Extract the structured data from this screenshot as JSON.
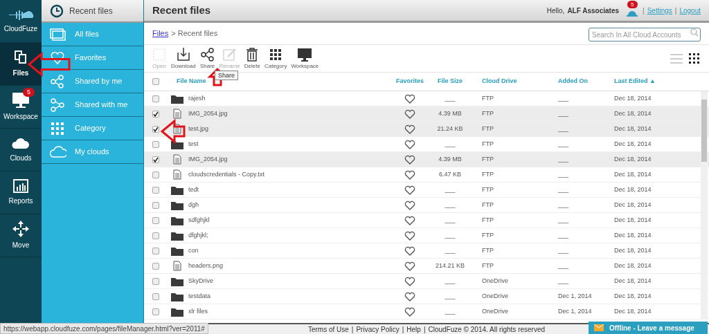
{
  "nav": [
    {
      "label": "CloudFuze",
      "kind": "logo",
      "selected": false
    },
    {
      "label": "Files",
      "kind": "files",
      "selected": true
    },
    {
      "label": "Workspace",
      "kind": "workspace",
      "selected": false,
      "badge": "5"
    },
    {
      "label": "Clouds",
      "kind": "clouds",
      "selected": false
    },
    {
      "label": "Reports",
      "kind": "reports",
      "selected": false
    },
    {
      "label": "Move",
      "kind": "move",
      "selected": false
    }
  ],
  "sidebar": {
    "title": "Recent files",
    "items": [
      {
        "label": "All files",
        "kind": "all"
      },
      {
        "label": "Favorites",
        "kind": "favorites"
      },
      {
        "label": "Shared by me",
        "kind": "sharedby"
      },
      {
        "label": "Shared with me",
        "kind": "sharedwith"
      },
      {
        "label": "Category",
        "kind": "category"
      },
      {
        "label": "My clouds",
        "kind": "clouds"
      }
    ]
  },
  "header": {
    "title": "Recent files",
    "greeting": "Hello,",
    "user": "ALF Associates",
    "notification_count": "5",
    "separator": "|",
    "links": [
      "Settings",
      "Logout"
    ]
  },
  "breadcrumb": {
    "link": "Files",
    "separator": ">",
    "current": "Recent files"
  },
  "search": {
    "placeholder": "Search In All Cloud Accounts"
  },
  "toolbar": [
    {
      "label": "Open",
      "kind": "open",
      "disabled": true
    },
    {
      "label": "Download",
      "kind": "download",
      "disabled": false
    },
    {
      "label": "Share",
      "kind": "share",
      "disabled": false
    },
    {
      "label": "Rename",
      "kind": "rename",
      "disabled": true
    },
    {
      "label": "Delete",
      "kind": "delete",
      "disabled": false
    },
    {
      "label": "Category",
      "kind": "category",
      "disabled": false
    },
    {
      "label": "Workspace",
      "kind": "workspace",
      "disabled": false
    }
  ],
  "tooltip": "Share",
  "views": [
    {
      "kind": "list",
      "selected": false
    },
    {
      "kind": "grid",
      "selected": true
    }
  ],
  "table": {
    "select_all_checked": false,
    "columns": [
      "File Name",
      "Favorites",
      "File Size",
      "Cloud Drive",
      "Added On",
      "Last Edited"
    ],
    "sort_indicator": "▲",
    "rows": [
      {
        "name": "rajesh",
        "kind": "folder",
        "checked": false,
        "size": "___",
        "drive": "FTP",
        "added": "___",
        "edited": "Dec 18, 2014"
      },
      {
        "name": "IMG_2054.jpg",
        "kind": "file",
        "checked": true,
        "size": "4.39 MB",
        "drive": "FTP",
        "added": "___",
        "edited": "Dec 18, 2014"
      },
      {
        "name": "test.jpg",
        "kind": "file",
        "checked": true,
        "size": "21.24 KB",
        "drive": "FTP",
        "added": "___",
        "edited": "Dec 18, 2014"
      },
      {
        "name": "test",
        "kind": "folder",
        "checked": false,
        "size": "___",
        "drive": "FTP",
        "added": "___",
        "edited": "Dec 18, 2014"
      },
      {
        "name": "IMG_2054.jpg",
        "kind": "file",
        "checked": true,
        "size": "4.39 MB",
        "drive": "FTP",
        "added": "___",
        "edited": "Dec 18, 2014"
      },
      {
        "name": "cloudscredentials - Copy.txt",
        "kind": "file",
        "checked": false,
        "size": "6.47 KB",
        "drive": "FTP",
        "added": "___",
        "edited": "Dec 18, 2014"
      },
      {
        "name": "tedt",
        "kind": "folder",
        "checked": false,
        "size": "___",
        "drive": "FTP",
        "added": "___",
        "edited": "Dec 18, 2014"
      },
      {
        "name": "dgh",
        "kind": "folder",
        "checked": false,
        "size": "___",
        "drive": "FTP",
        "added": "___",
        "edited": "Dec 18, 2014"
      },
      {
        "name": "sdfghjkl",
        "kind": "folder",
        "checked": false,
        "size": "___",
        "drive": "FTP",
        "added": "___",
        "edited": "Dec 18, 2014"
      },
      {
        "name": "dfghjkl;",
        "kind": "folder",
        "checked": false,
        "size": "___",
        "drive": "FTP",
        "added": "___",
        "edited": "Dec 18, 2014"
      },
      {
        "name": "con",
        "kind": "folder",
        "checked": false,
        "size": "___",
        "drive": "FTP",
        "added": "___",
        "edited": "Dec 18, 2014"
      },
      {
        "name": "headers.png",
        "kind": "file",
        "checked": false,
        "size": "214.21 KB",
        "drive": "FTP",
        "added": "___",
        "edited": "Dec 18, 2014"
      },
      {
        "name": "SkyDrive",
        "kind": "folder",
        "checked": false,
        "size": "___",
        "drive": "OneDrive",
        "added": "___",
        "edited": "Dec 18, 2014"
      },
      {
        "name": "testdata",
        "kind": "folder",
        "checked": false,
        "size": "___",
        "drive": "OneDrive",
        "added": "Dec 1, 2014",
        "edited": "Dec 18, 2014"
      },
      {
        "name": "xlr files",
        "kind": "folder",
        "checked": false,
        "size": "___",
        "drive": "OneDrive",
        "added": "Dec 1, 2014",
        "edited": "Dec 18, 2014"
      }
    ]
  },
  "footer": {
    "separator": "|",
    "links": [
      "Terms of Use",
      "Privacy Policy",
      "Help"
    ],
    "copyright": "CloudFuze © 2014. All rights reserved"
  },
  "chat": {
    "label": "Offline - Leave a message"
  },
  "status_url": "https://webapp.cloudfuze.com/pages/fileManager.html?ver=2011#",
  "annotations": [
    {
      "kind": "left-arrow"
    },
    {
      "kind": "up-arrow"
    },
    {
      "kind": "left-arrow"
    }
  ]
}
